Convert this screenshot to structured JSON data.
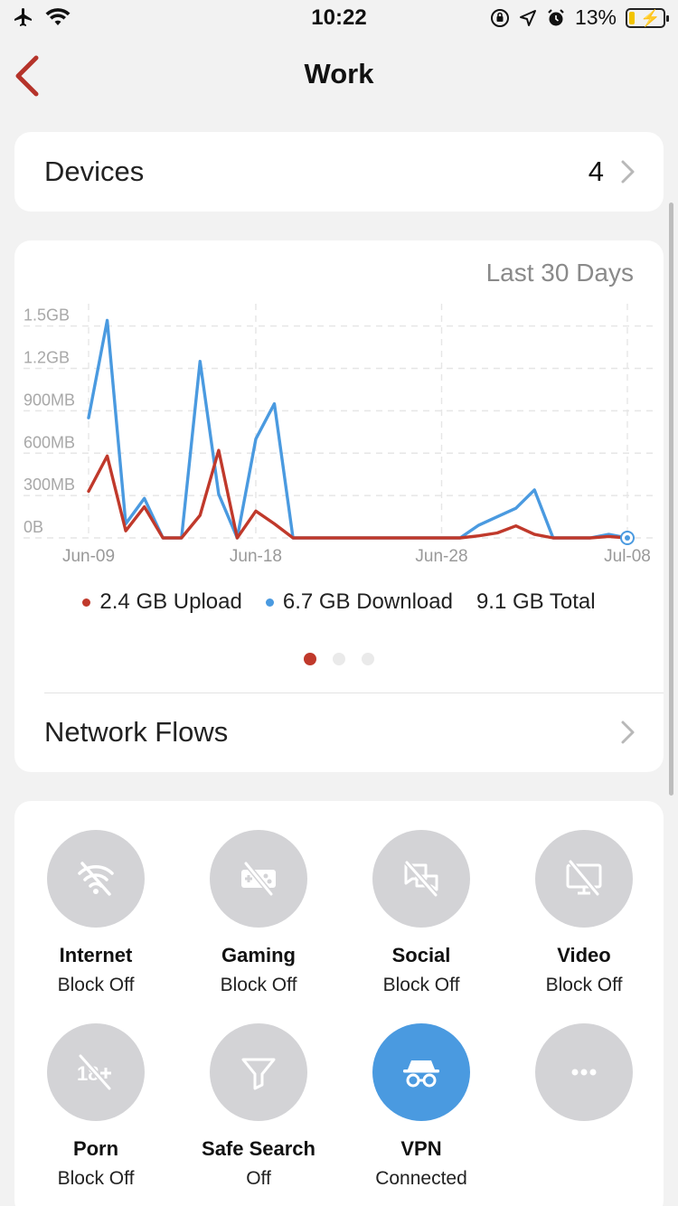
{
  "status_bar": {
    "time": "10:22",
    "battery_percent": "13%"
  },
  "nav": {
    "title": "Work"
  },
  "devices": {
    "label": "Devices",
    "count": "4"
  },
  "chart": {
    "period": "Last 30 Days"
  },
  "chart_data": {
    "type": "line",
    "y_ticks": [
      "0B",
      "300MB",
      "600MB",
      "900MB",
      "1.2GB",
      "1.5GB"
    ],
    "y_tick_values_mb": [
      0,
      300,
      600,
      900,
      1200,
      1500
    ],
    "ylim_mb": [
      0,
      1600
    ],
    "x_ticks": [
      {
        "label": "Jun-09",
        "day": 0
      },
      {
        "label": "Jun-18",
        "day": 9
      },
      {
        "label": "Jun-28",
        "day": 19
      },
      {
        "label": "Jul-08",
        "day": 29
      }
    ],
    "grid": true,
    "series": [
      {
        "name": "Download",
        "color": "#4a9ae0",
        "values_mb": [
          850,
          1540,
          100,
          280,
          0,
          0,
          1250,
          310,
          0,
          700,
          950,
          0,
          0,
          0,
          0,
          0,
          0,
          0,
          0,
          0,
          0,
          90,
          150,
          210,
          340,
          0,
          0,
          0,
          25,
          0
        ]
      },
      {
        "name": "Upload",
        "color": "#c0392b",
        "values_mb": [
          330,
          580,
          50,
          220,
          0,
          0,
          160,
          620,
          0,
          190,
          100,
          0,
          0,
          0,
          0,
          0,
          0,
          0,
          0,
          0,
          0,
          15,
          35,
          85,
          25,
          0,
          0,
          0,
          10,
          0
        ]
      }
    ]
  },
  "legend": {
    "upload": "2.4 GB Upload",
    "download": "6.7 GB Download",
    "total": "9.1 GB Total",
    "upload_color": "#c0392b",
    "download_color": "#4a9ae0"
  },
  "network_flows": {
    "label": "Network Flows"
  },
  "actions": [
    {
      "name": "Internet",
      "state": "Block Off",
      "icon": "wifi-off-icon",
      "active": false
    },
    {
      "name": "Gaming",
      "state": "Block Off",
      "icon": "gamepad-off-icon",
      "active": false
    },
    {
      "name": "Social",
      "state": "Block Off",
      "icon": "chat-off-icon",
      "active": false
    },
    {
      "name": "Video",
      "state": "Block Off",
      "icon": "monitor-off-icon",
      "active": false
    },
    {
      "name": "Porn",
      "state": "Block Off",
      "icon": "18plus-off-icon",
      "active": false
    },
    {
      "name": "Safe Search",
      "state": "Off",
      "icon": "filter-icon",
      "active": false
    },
    {
      "name": "VPN",
      "state": "Connected",
      "icon": "incognito-icon",
      "active": true
    },
    {
      "name": "",
      "state": "",
      "icon": "more-icon",
      "active": false
    }
  ]
}
